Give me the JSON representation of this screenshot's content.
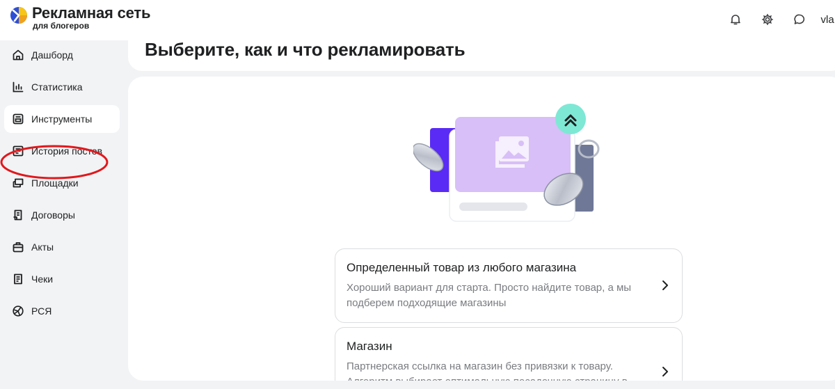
{
  "header": {
    "logo_title": "Рекламная сеть",
    "logo_subtitle": "для блогеров",
    "icons": [
      "bell-icon",
      "gear-icon",
      "chat-icon"
    ],
    "user_name": "vla"
  },
  "sidebar": {
    "items": [
      {
        "label": "Дашборд",
        "icon": "home-icon"
      },
      {
        "label": "Статистика",
        "icon": "bar-chart-icon"
      },
      {
        "label": "Инструменты",
        "icon": "tools-icon",
        "active": true
      },
      {
        "label": "История постов",
        "icon": "history-icon"
      },
      {
        "label": "Площадки",
        "icon": "platforms-icon"
      },
      {
        "label": "Договоры",
        "icon": "contract-icon"
      },
      {
        "label": "Акты",
        "icon": "briefcase-icon"
      },
      {
        "label": "Чеки",
        "icon": "receipt-icon"
      },
      {
        "label": "РСЯ",
        "icon": "network-icon"
      }
    ]
  },
  "main": {
    "page_title": "Выберите, как и что рекламировать",
    "options": [
      {
        "title": "Определенный товар из любого магазина",
        "description": "Хороший вариант для старта. Просто найдите товар, а мы подберем подходящие магазины"
      },
      {
        "title": "Магазин",
        "description": "Партнерская ссылка на магазин без привязки к товару. Алгоритм выбирает оптимальную посадочную страницу в"
      }
    ]
  },
  "colors": {
    "annotation": "#e0181c",
    "illustration_purple": "#d8bff7",
    "illustration_blue": "#5a2bf5",
    "illustration_badge": "#7ee8d5"
  }
}
